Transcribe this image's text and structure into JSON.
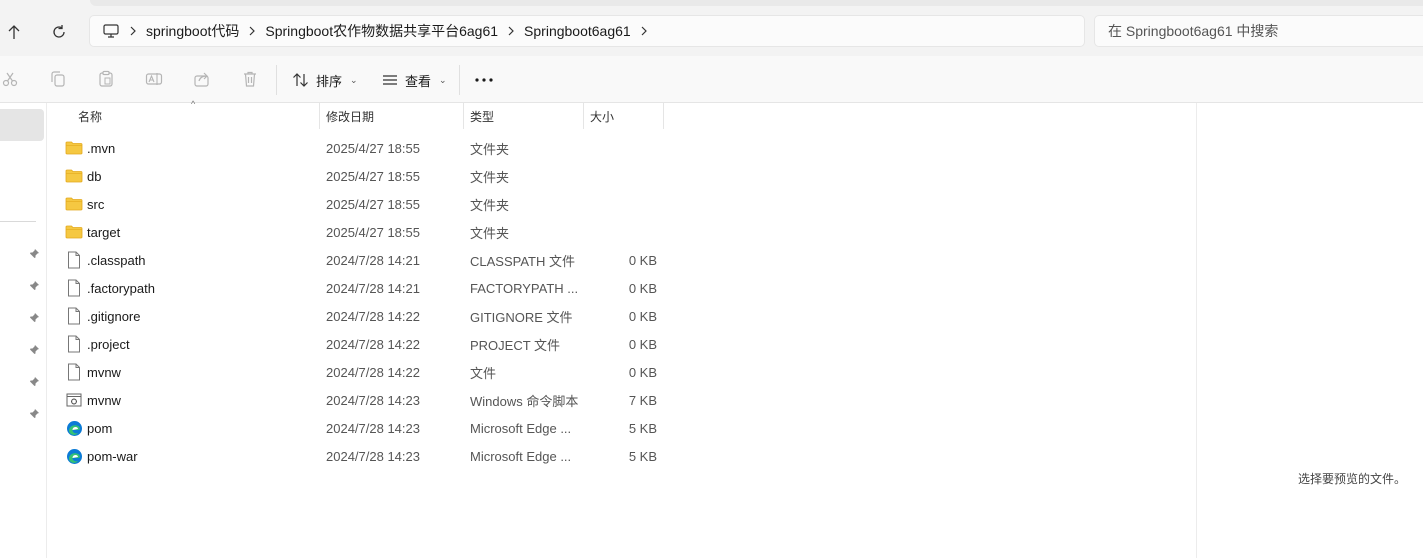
{
  "address": {
    "crumbs": [
      "springboot代码",
      "Springboot农作物数据共享平台6ag61",
      "Springboot6ag61"
    ]
  },
  "search": {
    "placeholder": "在 Springboot6ag61 中搜索"
  },
  "toolbar": {
    "icons": [
      "cut-icon",
      "copy-icon",
      "paste-icon",
      "rename-icon",
      "share-icon",
      "delete-icon"
    ],
    "sort_label": "排序",
    "view_label": "查看",
    "more_label": "..."
  },
  "columns": {
    "name": "名称",
    "date": "修改日期",
    "type": "类型",
    "size": "大小"
  },
  "files": [
    {
      "name": ".mvn",
      "date": "2025/4/27 18:55",
      "type": "文件夹",
      "size": "",
      "icon": "folder-icon"
    },
    {
      "name": "db",
      "date": "2025/4/27 18:55",
      "type": "文件夹",
      "size": "",
      "icon": "folder-icon"
    },
    {
      "name": "src",
      "date": "2025/4/27 18:55",
      "type": "文件夹",
      "size": "",
      "icon": "folder-icon"
    },
    {
      "name": "target",
      "date": "2025/4/27 18:55",
      "type": "文件夹",
      "size": "",
      "icon": "folder-icon"
    },
    {
      "name": ".classpath",
      "date": "2024/7/28 14:21",
      "type": "CLASSPATH 文件",
      "size": "0 KB",
      "icon": "file-icon"
    },
    {
      "name": ".factorypath",
      "date": "2024/7/28 14:21",
      "type": "FACTORYPATH ...",
      "size": "0 KB",
      "icon": "file-icon"
    },
    {
      "name": ".gitignore",
      "date": "2024/7/28 14:22",
      "type": "GITIGNORE 文件",
      "size": "0 KB",
      "icon": "file-icon"
    },
    {
      "name": ".project",
      "date": "2024/7/28 14:22",
      "type": "PROJECT 文件",
      "size": "0 KB",
      "icon": "file-icon"
    },
    {
      "name": "mvnw",
      "date": "2024/7/28 14:22",
      "type": "文件",
      "size": "0 KB",
      "icon": "file-icon"
    },
    {
      "name": "mvnw",
      "date": "2024/7/28 14:23",
      "type": "Windows 命令脚本",
      "size": "7 KB",
      "icon": "script-icon"
    },
    {
      "name": "pom",
      "date": "2024/7/28 14:23",
      "type": "Microsoft Edge ...",
      "size": "5 KB",
      "icon": "edge-icon"
    },
    {
      "name": "pom-war",
      "date": "2024/7/28 14:23",
      "type": "Microsoft Edge ...",
      "size": "5 KB",
      "icon": "edge-icon"
    }
  ],
  "preview": {
    "message": "选择要预览的文件。"
  },
  "colors": {
    "folder": "#f5c842",
    "folder_dark": "#e3a81c",
    "edge_blue": "#0c7bd6",
    "edge_green": "#34c275",
    "selection": "#e5e5e5"
  }
}
